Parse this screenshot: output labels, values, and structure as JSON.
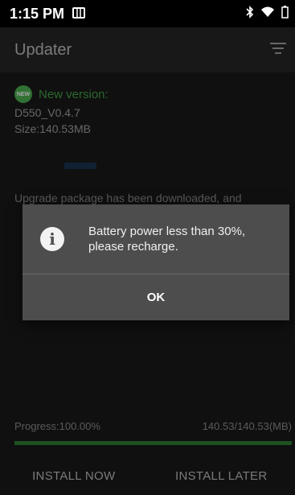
{
  "status_bar": {
    "time": "1:15 PM",
    "icons": [
      "notification-icon",
      "bluetooth-icon",
      "wifi-icon",
      "battery-icon"
    ]
  },
  "app_bar": {
    "title": "Updater",
    "menu_icon": "filter-list-icon"
  },
  "update": {
    "new_badge": "NEW",
    "new_version_label": "New version:",
    "version": "D550_V0.4.7",
    "size": "Size:140.53MB",
    "notice": "Upgrade package has been downloaded, and"
  },
  "progress": {
    "label": "Progress:100.00%",
    "amount": "140.53/140.53(MB)",
    "fraction": 1.0
  },
  "actions": {
    "install_now": "INSTALL NOW",
    "install_later": "INSTALL LATER"
  },
  "dialog": {
    "icon": "info-icon",
    "message": "Battery power less than 30%, please recharge.",
    "ok_label": "OK"
  },
  "colors": {
    "accent_green": "#4caf50",
    "dialog_bg": "#4d4d4d"
  }
}
